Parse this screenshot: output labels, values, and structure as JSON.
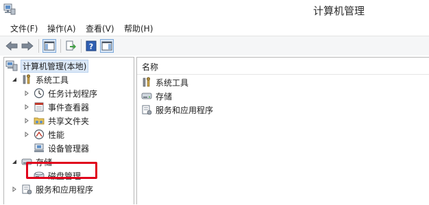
{
  "window": {
    "title": "计算机管理"
  },
  "menubar": {
    "items": [
      {
        "label": "文件(F)"
      },
      {
        "label": "操作(A)"
      },
      {
        "label": "查看(V)"
      },
      {
        "label": "帮助(H)"
      }
    ]
  },
  "toolbar": {
    "buttons": [
      {
        "icon": "back-arrow-icon"
      },
      {
        "icon": "forward-arrow-icon"
      },
      {
        "icon": "show-hide-console-tree-icon"
      },
      {
        "icon": "export-list-icon"
      },
      {
        "icon": "help-icon"
      },
      {
        "icon": "show-hide-action-pane-icon"
      }
    ]
  },
  "tree": {
    "root": {
      "label": "计算机管理(本地)",
      "icon": "computer-management-icon",
      "expanded": true,
      "selected": true
    },
    "system_tools": {
      "label": "系统工具",
      "icon": "system-tools-icon",
      "expanded": true,
      "children": [
        {
          "label": "任务计划程序",
          "icon": "task-scheduler-icon",
          "expandable": true
        },
        {
          "label": "事件查看器",
          "icon": "event-viewer-icon",
          "expandable": true
        },
        {
          "label": "共享文件夹",
          "icon": "shared-folders-icon",
          "expandable": true
        },
        {
          "label": "性能",
          "icon": "performance-icon",
          "expandable": true
        },
        {
          "label": "设备管理器",
          "icon": "device-manager-icon",
          "expandable": false
        }
      ]
    },
    "storage": {
      "label": "存储",
      "icon": "storage-icon",
      "expanded": true,
      "children": [
        {
          "label": "磁盘管理",
          "icon": "disk-management-icon",
          "expandable": false,
          "highlighted": true
        }
      ]
    },
    "services": {
      "label": "服务和应用程序",
      "icon": "services-apps-icon",
      "expandable": true
    }
  },
  "list": {
    "column_name": "名称",
    "items": [
      {
        "label": "系统工具",
        "icon": "system-tools-icon"
      },
      {
        "label": "存储",
        "icon": "storage-icon"
      },
      {
        "label": "服务和应用程序",
        "icon": "services-apps-icon"
      }
    ]
  },
  "colors": {
    "highlight_border": "#e0001b",
    "selection_bg": "#dbe8f7"
  }
}
